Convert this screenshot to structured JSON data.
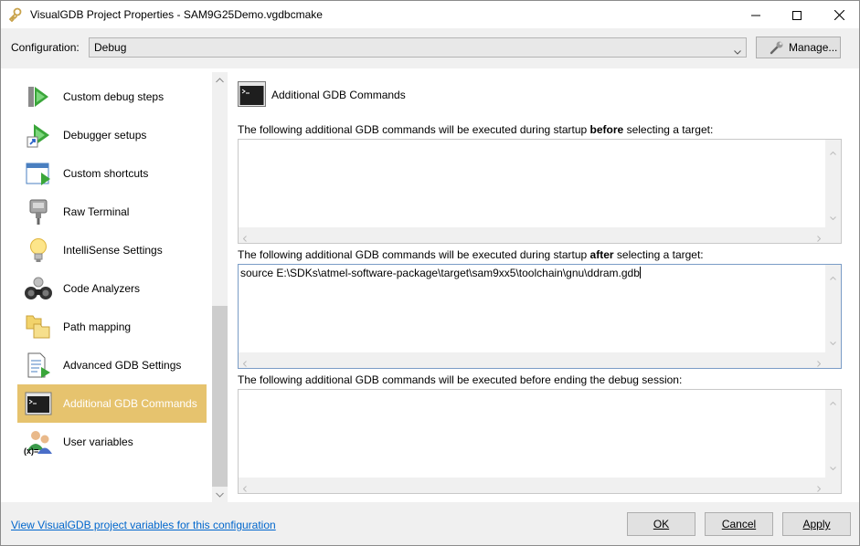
{
  "window": {
    "title": "VisualGDB Project Properties - SAM9G25Demo.vgdbcmake"
  },
  "toolbar": {
    "config_label": "Configuration:",
    "config_value": "Debug",
    "manage_label": "Manage..."
  },
  "sidebar": {
    "items": [
      {
        "label": "Custom debug steps",
        "icon": "debug-steps-icon"
      },
      {
        "label": "Debugger setups",
        "icon": "debugger-setups-icon"
      },
      {
        "label": "Custom shortcuts",
        "icon": "shortcuts-icon"
      },
      {
        "label": "Raw Terminal",
        "icon": "serial-cable-icon"
      },
      {
        "label": "IntelliSense Settings",
        "icon": "lightbulb-icon"
      },
      {
        "label": "Code Analyzers",
        "icon": "binoculars-icon"
      },
      {
        "label": "Path mapping",
        "icon": "folders-icon"
      },
      {
        "label": "Advanced GDB Settings",
        "icon": "document-arrow-icon"
      },
      {
        "label": "Additional GDB Commands",
        "icon": "console-icon"
      },
      {
        "label": "User variables",
        "icon": "user-variables-icon"
      }
    ],
    "selected_index": 8
  },
  "content": {
    "title": "Additional GDB Commands",
    "before": {
      "prefix": "The following additional GDB commands will be executed during startup",
      "emph": "before",
      "suffix": "selecting a target:",
      "value": ""
    },
    "after": {
      "prefix": "The following additional GDB commands will be executed during startup",
      "emph": "after",
      "suffix": "selecting a target:",
      "value": "source E:\\SDKs\\atmel-software-package\\target\\sam9xx5\\toolchain\\gnu\\ddram.gdb"
    },
    "end": {
      "label": "The following additional GDB commands will be executed before ending the debug session:",
      "value": ""
    }
  },
  "footer": {
    "link": "View VisualGDB project variables for this configuration",
    "ok_label": "OK",
    "cancel_label": "Cancel",
    "apply_label": "Apply"
  },
  "colors": {
    "selection": "#e6c36e",
    "link": "#0066cc",
    "chrome": "#f0f0f0"
  }
}
